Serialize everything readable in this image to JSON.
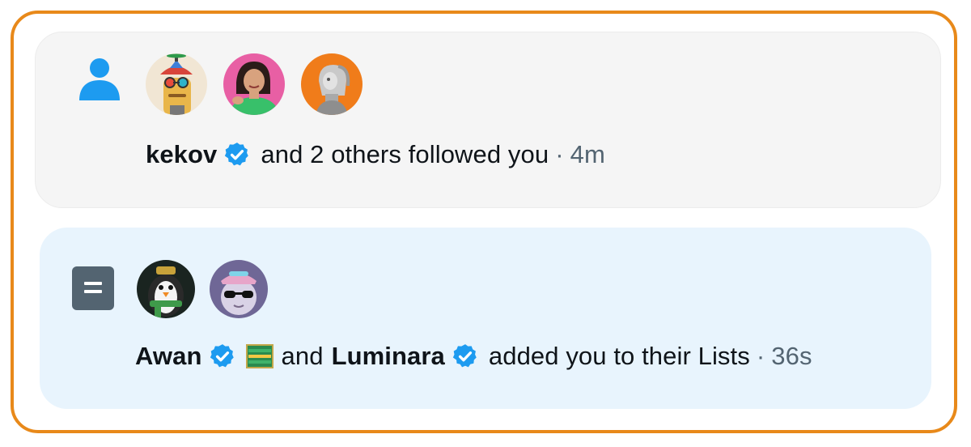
{
  "notifications": [
    {
      "type_icon": "person-icon",
      "avatars": [
        "avatar-propeller-hat",
        "avatar-woman-green-top",
        "avatar-robot-orange"
      ],
      "name": "kekov",
      "verified": true,
      "text": "and 2 others followed you",
      "separator": "·",
      "time": "4m"
    },
    {
      "type_icon": "list-icon",
      "avatars": [
        "avatar-penguin-scarf",
        "avatar-cat-sunglasses"
      ],
      "name1": "Awan",
      "verified1": true,
      "emoji": "flag-emoji",
      "connector": "and",
      "name2": "Luminara",
      "verified2": true,
      "text": "added you to their Lists",
      "separator": "·",
      "time": "36s"
    }
  ],
  "colors": {
    "frame_border": "#e8891a",
    "follow_bg": "#f5f5f5",
    "lists_bg": "#e8f4fd",
    "verified_blue": "#1d9bf0",
    "person_icon": "#1d9bf0",
    "list_icon": "#536471"
  }
}
